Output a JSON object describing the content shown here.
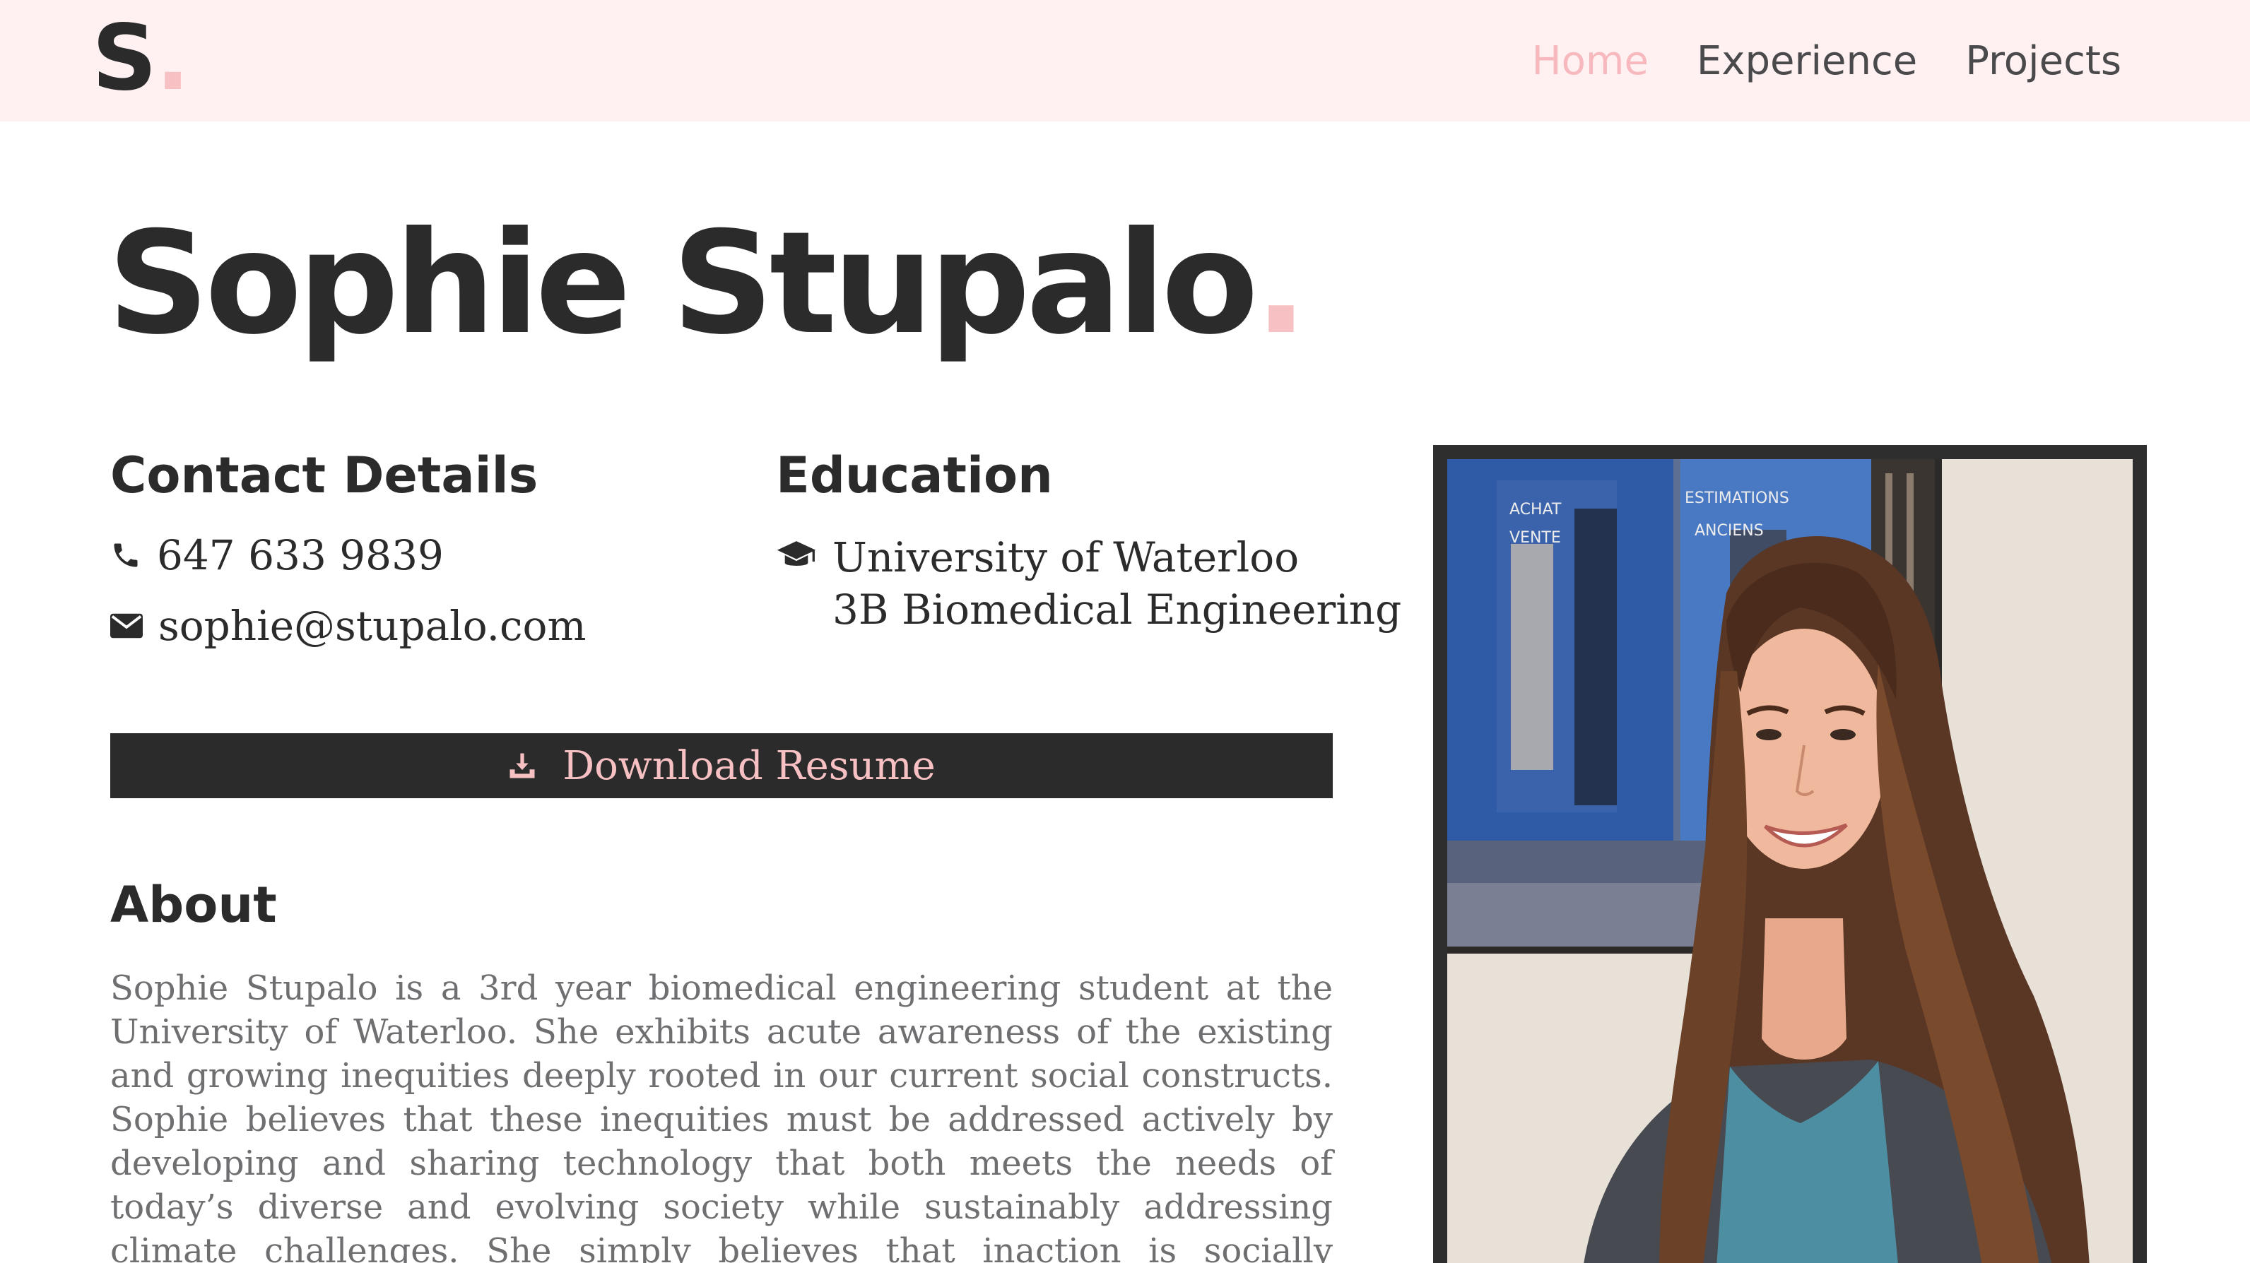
{
  "nav": {
    "logo_letter": "S",
    "logo_dot": ".",
    "links": [
      {
        "label": "Home",
        "active": true
      },
      {
        "label": "Experience",
        "active": false
      },
      {
        "label": "Projects",
        "active": false
      }
    ]
  },
  "hero": {
    "name": "Sophie Stupalo",
    "dot": "."
  },
  "contact": {
    "heading": "Contact Details",
    "phone": "647 633 9839",
    "email": "sophie@stupalo.com"
  },
  "education": {
    "heading": "Education",
    "school": "University of Waterloo",
    "program": "3B Biomedical Engineering"
  },
  "download": {
    "label": "Download Resume"
  },
  "about": {
    "heading": "About",
    "text": "Sophie Stupalo is a 3rd year biomedical engineering student at the University of Waterloo. She exhibits acute awareness of the existing and growing inequities deeply rooted in our current social constructs. Sophie believes that these inequities must be addressed actively by developing and sharing technology that both meets the needs of today’s diverse and evolving society while sustainably addressing climate challenges. She simply believes that inaction is socially inexcusable and morally unforgivable."
  },
  "photo": {
    "sign_left_1": "ACHAT",
    "sign_left_2": "VENTE",
    "sign_right_1": "ESTIMATIONS",
    "sign_right_2": "ANCIENS"
  },
  "icons": {
    "phone": "phone-icon",
    "email": "envelope-icon",
    "education": "graduation-cap-icon",
    "download": "download-icon"
  },
  "colors": {
    "accent": "#f7c0c3",
    "nav_background": "#fff1f1",
    "text_dark": "#2b2b2c",
    "text_muted": "#6f6f72",
    "button_background": "#2b2b2c"
  }
}
